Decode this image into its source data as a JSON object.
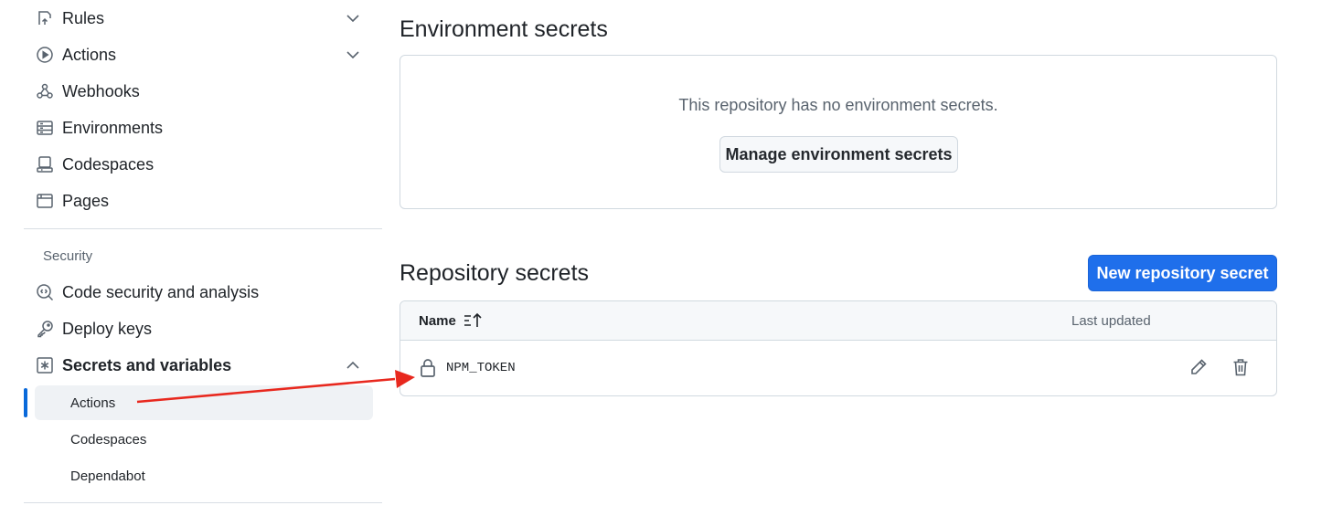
{
  "sidebar": {
    "items": [
      {
        "label": "Rules",
        "icon": "rules-icon",
        "chevron": "down"
      },
      {
        "label": "Actions",
        "icon": "play-circle-icon",
        "chevron": "down"
      },
      {
        "label": "Webhooks",
        "icon": "webhook-icon"
      },
      {
        "label": "Environments",
        "icon": "server-icon"
      },
      {
        "label": "Codespaces",
        "icon": "codespaces-icon"
      },
      {
        "label": "Pages",
        "icon": "browser-icon"
      }
    ],
    "security_section": {
      "title": "Security",
      "items": [
        {
          "label": "Code security and analysis",
          "icon": "codescan-icon"
        },
        {
          "label": "Deploy keys",
          "icon": "key-icon"
        },
        {
          "label": "Secrets and variables",
          "icon": "asterisk-icon",
          "chevron": "up"
        }
      ],
      "sub_items": [
        {
          "label": "Actions",
          "active": true
        },
        {
          "label": "Codespaces",
          "active": false
        },
        {
          "label": "Dependabot",
          "active": false
        }
      ]
    }
  },
  "environment_secrets": {
    "title": "Environment secrets",
    "empty_message": "This repository has no environment secrets.",
    "manage_button": "Manage environment secrets"
  },
  "repository_secrets": {
    "title": "Repository secrets",
    "new_button": "New repository secret",
    "columns": {
      "name": "Name",
      "last_updated": "Last updated"
    },
    "rows": [
      {
        "name": "NPM_TOKEN",
        "last_updated": ""
      }
    ]
  },
  "colors": {
    "accent": "#1f6feb",
    "active_indicator": "#0969da",
    "annotation_arrow": "#e8281e"
  }
}
